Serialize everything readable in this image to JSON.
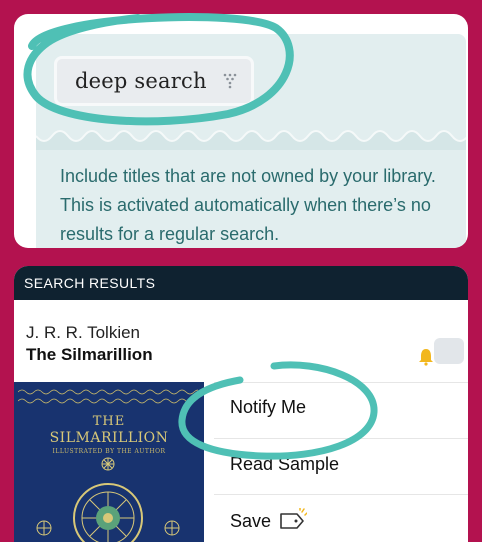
{
  "deep_search": {
    "chip_label": "deep search",
    "chip_icon": "filter-icon",
    "description": "Include titles that are not owned by your library. This is activated automatically when there’s no results for a regular search."
  },
  "results": {
    "header": "SEARCH RESULTS",
    "book": {
      "author": "J. R. R. Tolkien",
      "title": "The Silmarillion",
      "cover_title_line1": "THE",
      "cover_title_line2": "SILMARILLION",
      "cover_subtitle": "ILLUSTRATED BY THE AUTHOR"
    },
    "menu": [
      {
        "label": "Notify Me"
      },
      {
        "label": "Read Sample"
      },
      {
        "label": "Save"
      }
    ]
  },
  "colors": {
    "background": "#b3124f",
    "highlight": "#4fc0b5",
    "panel": "#e2eeef",
    "description_text": "#2a6b6d",
    "header_bar": "#0f2230",
    "cover": "#18336f"
  }
}
